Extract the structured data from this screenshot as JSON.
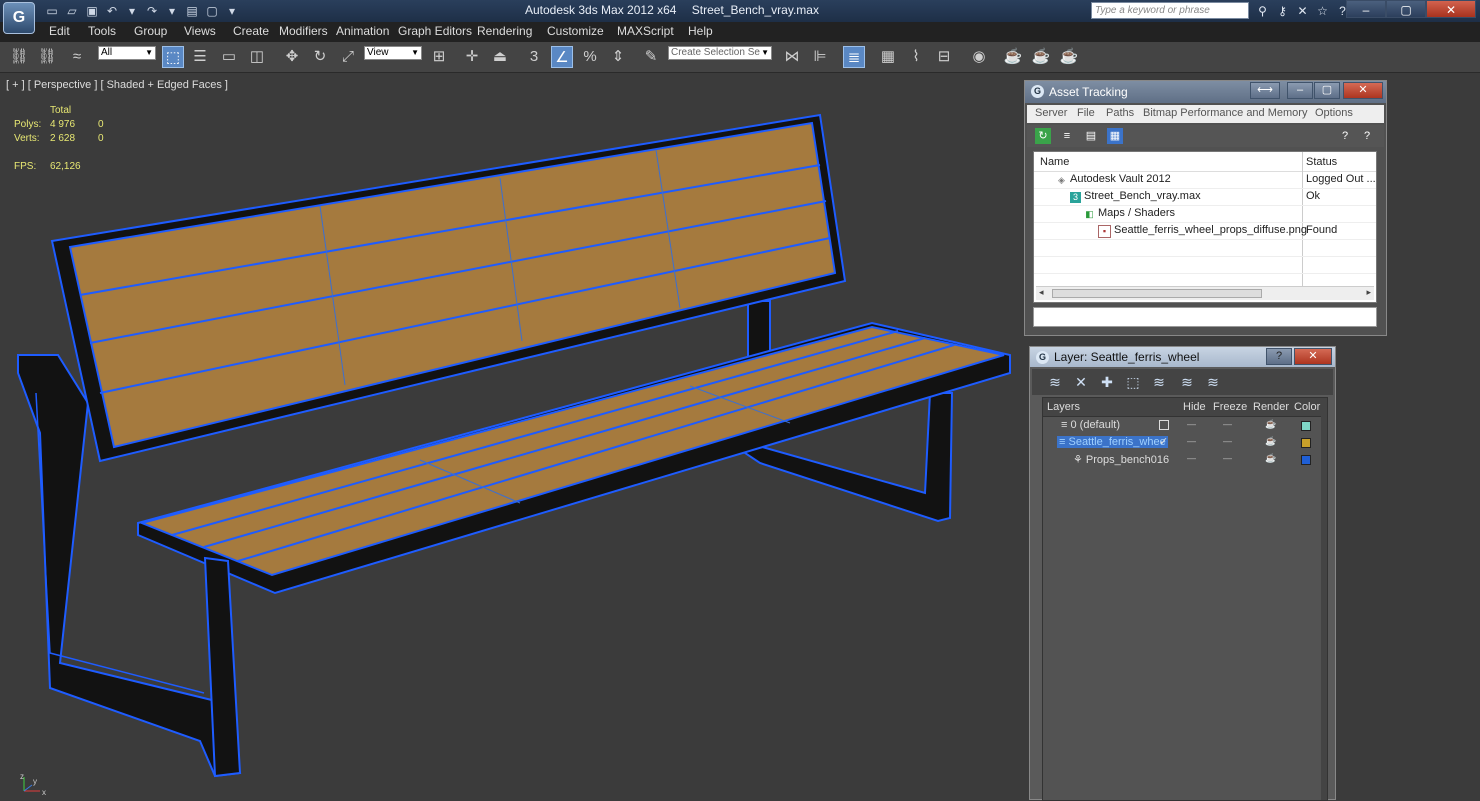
{
  "app": {
    "logo": "G",
    "title": "Autodesk 3ds Max  2012 x64",
    "file": "Street_Bench_vray.max",
    "search_placeholder": "Type a keyword or phrase"
  },
  "menu": [
    "Edit",
    "Tools",
    "Group",
    "Views",
    "Create",
    "Modifiers",
    "Animation",
    "Graph Editors",
    "Rendering",
    "Customize",
    "MAXScript",
    "Help"
  ],
  "toolbar": {
    "filter_value": "All",
    "ref_coord_value": "View",
    "selection_set_placeholder": "Create Selection Se",
    "snap_label": "3",
    "percent_label": "%"
  },
  "viewport": {
    "label": "[ + ] [ Perspective ] [ Shaded + Edged Faces ]",
    "stats": {
      "total_label": "Total",
      "polys_label": "Polys:",
      "polys_total": "4 976",
      "polys_sel": "0",
      "verts_label": "Verts:",
      "verts_total": "2 628",
      "verts_sel": "0",
      "fps_label": "FPS:",
      "fps_value": "62,126"
    },
    "axis": {
      "x": "x",
      "y": "y",
      "z": "z"
    }
  },
  "asset_tracking": {
    "title": "Asset Tracking",
    "menu": [
      "Server",
      "File",
      "Paths",
      "Bitmap Performance and Memory",
      "Options"
    ],
    "columns": {
      "name": "Name",
      "status": "Status"
    },
    "rows": [
      {
        "name": "Autodesk Vault 2012",
        "status": "Logged Out ..."
      },
      {
        "name": "Street_Bench_vray.max",
        "status": "Ok"
      },
      {
        "name": "Maps / Shaders",
        "status": ""
      },
      {
        "name": "Seattle_ferris_wheel_props_diffuse.png",
        "status": "Found"
      }
    ]
  },
  "layer_dialog": {
    "title": "Layer: Seattle_ferris_wheel",
    "columns": {
      "layers": "Layers",
      "hide": "Hide",
      "freeze": "Freeze",
      "render": "Render",
      "color": "Color"
    },
    "rows": [
      {
        "name": "0 (default)",
        "color": "#7fd6c6"
      },
      {
        "name": "Seattle_ferris_whee",
        "color": "#c8a02a"
      },
      {
        "name": "Props_bench016",
        "color": "#1f5fd6"
      }
    ]
  },
  "colors": {
    "accent": "#3b73c9",
    "wood": "#a57a3e",
    "wire": "#1e5cff",
    "frame": "#141414",
    "viewport_bg": "#3b3b3b"
  }
}
